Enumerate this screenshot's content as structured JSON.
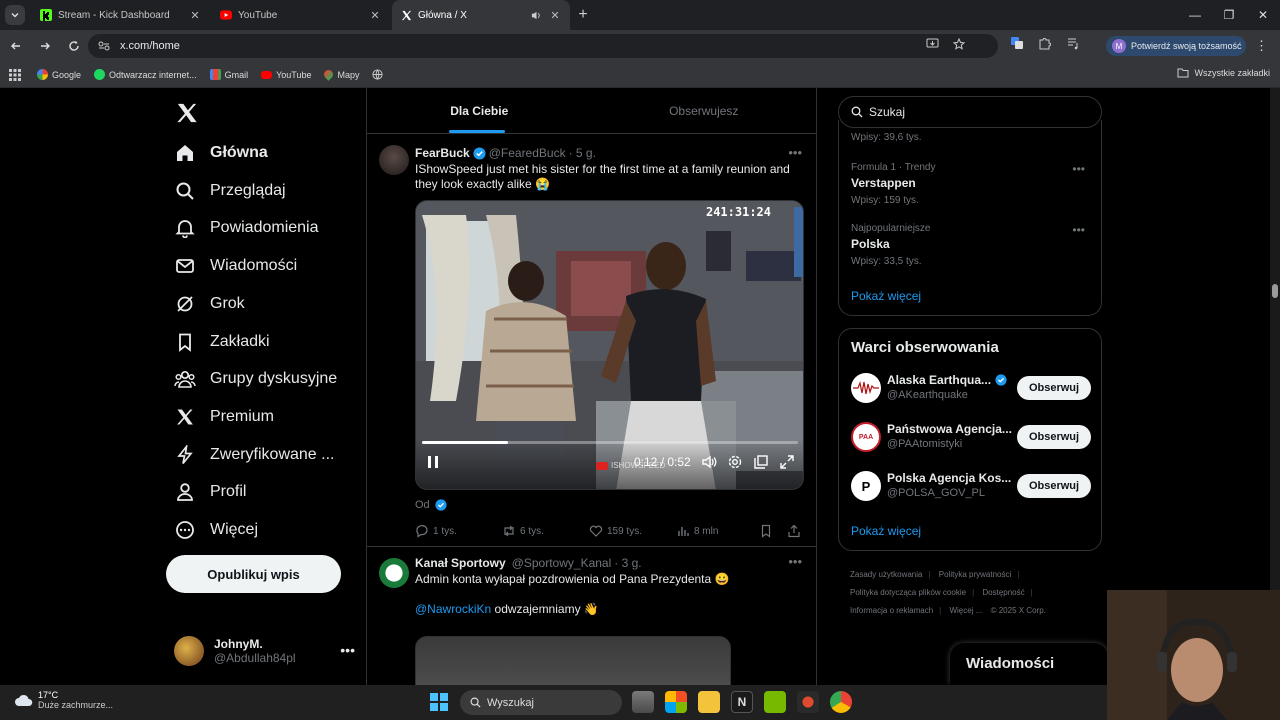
{
  "browser": {
    "tabs": [
      {
        "title": "Stream - Kick Dashboard",
        "icon": "kick-icon"
      },
      {
        "title": "YouTube",
        "icon": "youtube-icon"
      },
      {
        "title": "Główna / X",
        "icon": "x-icon",
        "active": true
      }
    ],
    "url": "x.com/home",
    "profile_pill": "Potwierdź swoją tożsamość",
    "profile_letter": "M"
  },
  "bookmarks": {
    "items": [
      "Google",
      "Odtwarzacz internet...",
      "Gmail",
      "YouTube",
      "Mapy"
    ],
    "all_label": "Wszystkie zakładki"
  },
  "nav": {
    "items": [
      {
        "label": "Główna",
        "icon": "home-icon"
      },
      {
        "label": "Przeglądaj",
        "icon": "search-icon"
      },
      {
        "label": "Powiadomienia",
        "icon": "bell-icon"
      },
      {
        "label": "Wiadomości",
        "icon": "mail-icon"
      },
      {
        "label": "Grok",
        "icon": "grok-icon"
      },
      {
        "label": "Zakładki",
        "icon": "bookmark-icon"
      },
      {
        "label": "Grupy dyskusyjne",
        "icon": "communities-icon"
      },
      {
        "label": "Premium",
        "icon": "x-premium-icon"
      },
      {
        "label": "Zweryfikowane ...",
        "icon": "lightning-icon"
      },
      {
        "label": "Profil",
        "icon": "person-icon"
      },
      {
        "label": "Więcej",
        "icon": "more-circle-icon"
      }
    ],
    "post_button": "Opublikuj wpis",
    "user": {
      "name": "JohnyM.",
      "handle": "@Abdullah84pl"
    }
  },
  "feed": {
    "tabs": [
      "Dla Ciebie",
      "Obserwujesz"
    ],
    "tweet1": {
      "name": "FearBuck",
      "handle": "@FearedBuck",
      "time": "· 5 g.",
      "text": "IShowSpeed just met his sister for the first time at a family reunion and they look exactly alike 😭",
      "video": {
        "stream_timer": "241:31:24",
        "time": "0:12 / 0:52",
        "progress": 0.23,
        "watermark": "ISHOWSPEED"
      },
      "from": "Od",
      "replies": "1 tys.",
      "reposts": "6 tys.",
      "likes": "159 tys.",
      "views": "8 mln"
    },
    "tweet2": {
      "name": "Kanał Sportowy",
      "handle": "@Sportowy_Kanal",
      "time": "· 3 g.",
      "text": "Admin konta wyłapał pozdrowienia od Pana Prezydenta 😀",
      "mention": "@NawrockiKn",
      "text2": " odwzajemniamy 👋"
    }
  },
  "sidebar": {
    "search_placeholder": "Szukaj",
    "trends_top_posts": "Wpisy: 39,6 tys.",
    "trends": [
      {
        "meta": "Formula 1 · Trendy",
        "title": "Verstappen",
        "posts": "Wpisy: 159 tys."
      },
      {
        "meta": "Najpopularniejsze",
        "title": "Polska",
        "posts": "Wpisy: 33,5 tys."
      }
    ],
    "show_more": "Pokaż więcej",
    "who_to_follow_title": "Warci obserwowania",
    "who_to_follow": [
      {
        "name": "Alaska Earthqua...",
        "handle": "@AKearthquake",
        "verified": true,
        "avatar": "seismograph-icon"
      },
      {
        "name": "Państwowa Agencja...",
        "handle": "@PAAtomistyki",
        "verified": false,
        "avatar": "paa-logo"
      },
      {
        "name": "Polska Agencja Kos...",
        "handle": "@POLSA_GOV_PL",
        "verified": false,
        "avatar": "polsa-logo"
      }
    ],
    "follow_label": "Obserwuj",
    "footer": [
      "Zasady użytkowania",
      "Polityka prywatności",
      "Polityka dotycząca plików cookie",
      "Dostępność",
      "Informacja o reklamach",
      "Więcej ...",
      "© 2025 X Corp."
    ]
  },
  "messages_drawer": "Wiadomości",
  "taskbar": {
    "temperature": "17°C",
    "weather": "Duże zachmurze...",
    "search": "Wyszukaj"
  },
  "colors": {
    "accent": "#1d9bf0",
    "background": "#000000",
    "border": "#2f3336"
  }
}
